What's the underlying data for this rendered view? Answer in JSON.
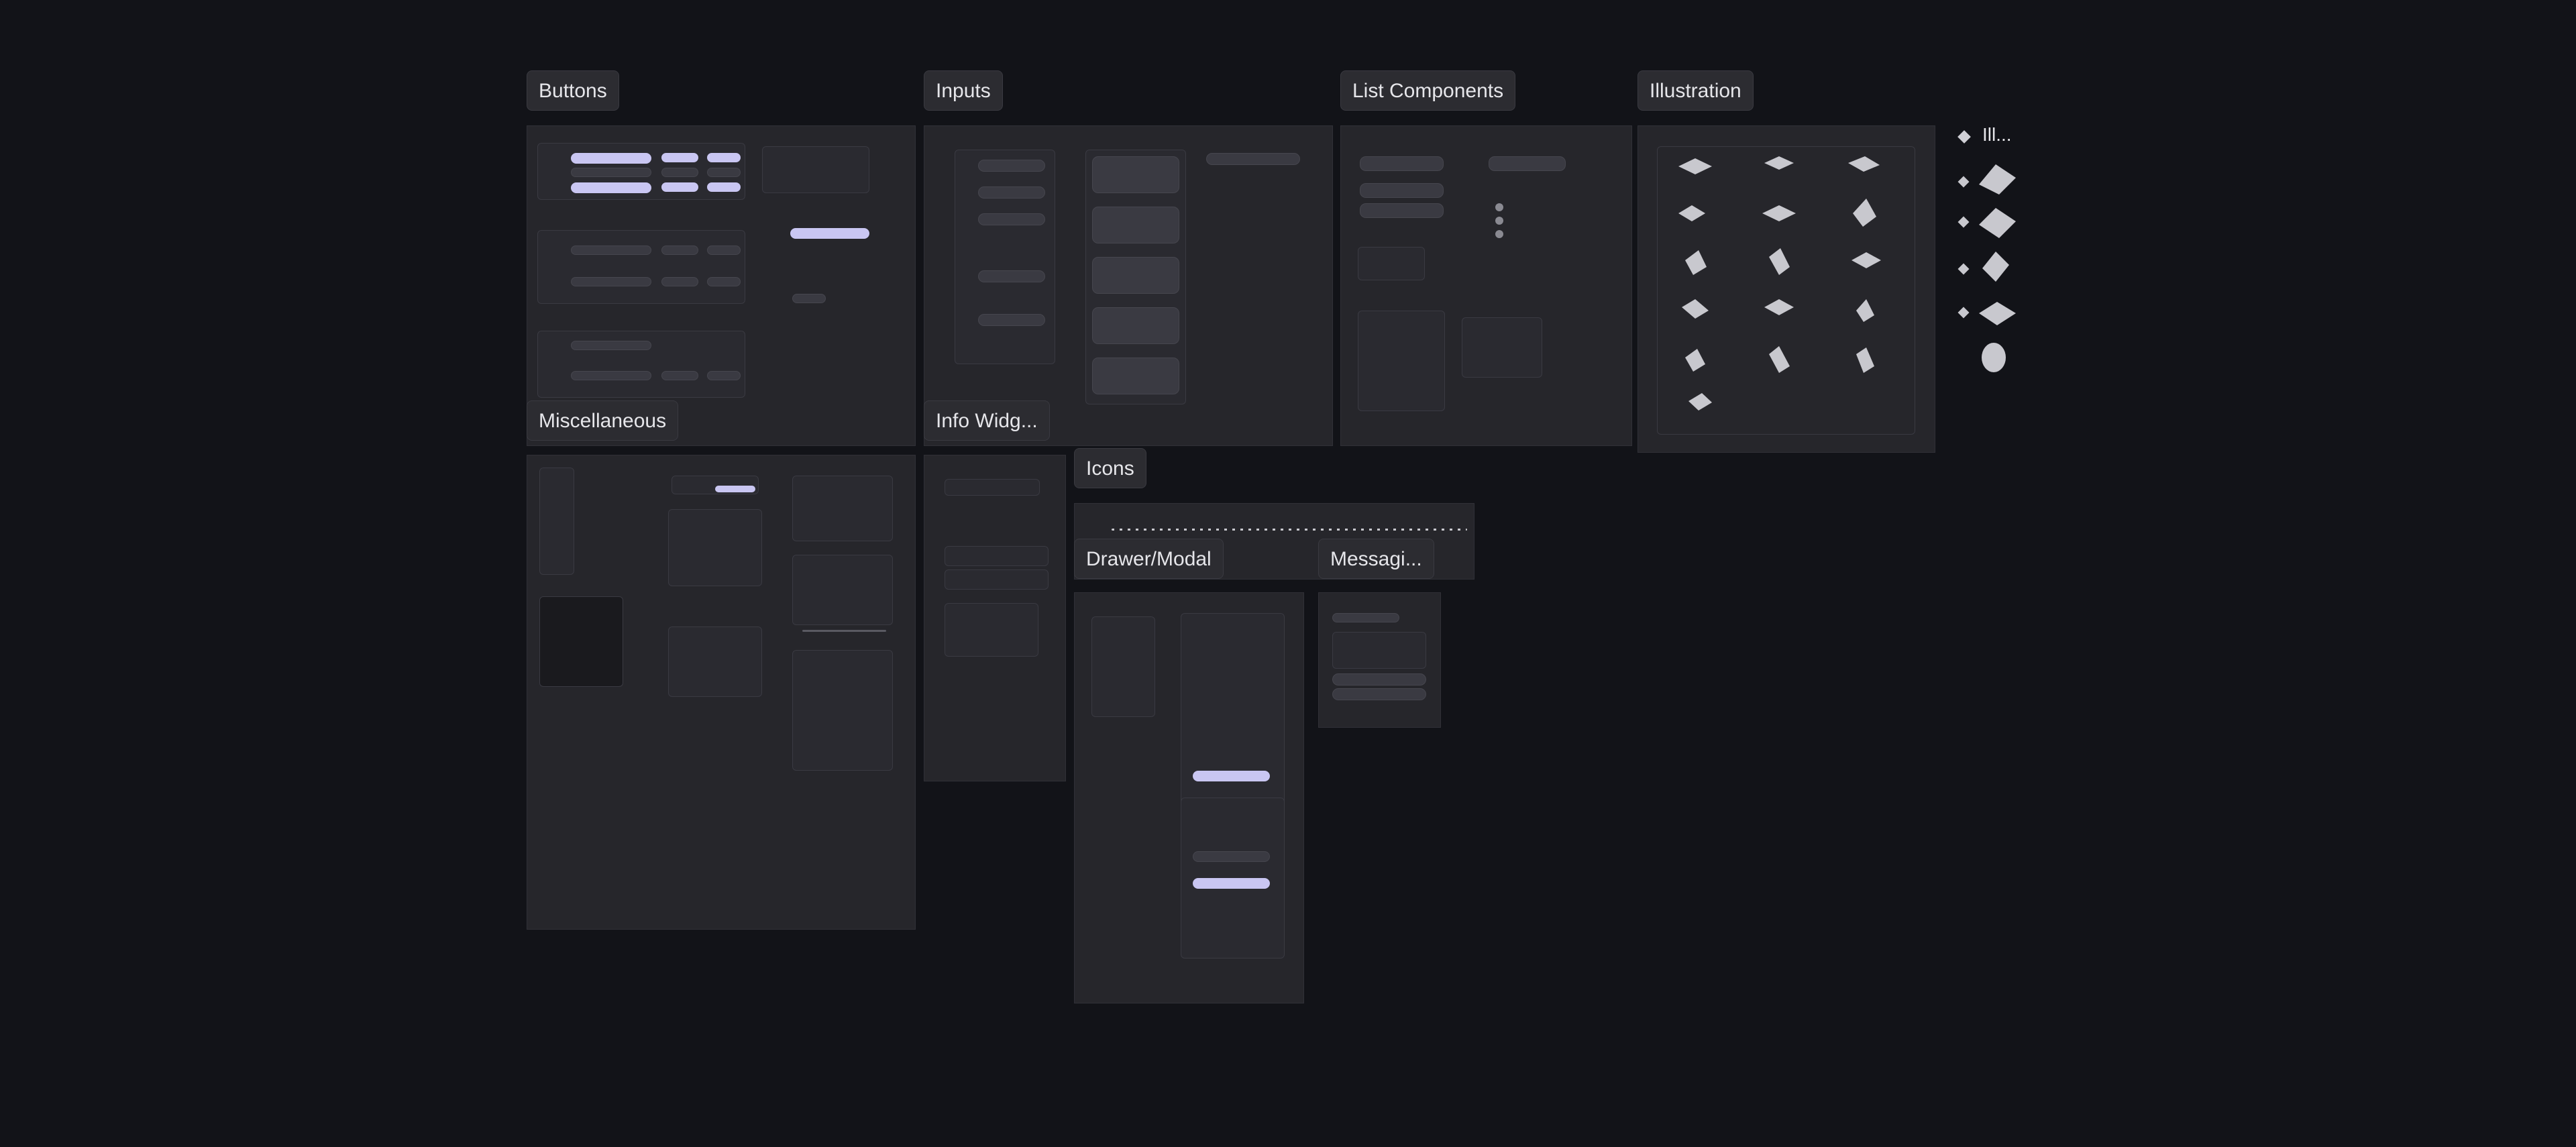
{
  "frames": {
    "buttons": "Buttons",
    "inputs": "Inputs",
    "list_components": "List Components",
    "illustration": "Illustration",
    "miscellaneous": "Miscellaneous",
    "info_widgets": "Info Widg...",
    "icons": "Icons",
    "drawer_modal": "Drawer/Modal",
    "messaging": "Messagi..."
  },
  "side_label": "Ill...",
  "colors": {
    "background": "#121318",
    "frame": "#26262b",
    "accent": "#c9c6f2"
  }
}
